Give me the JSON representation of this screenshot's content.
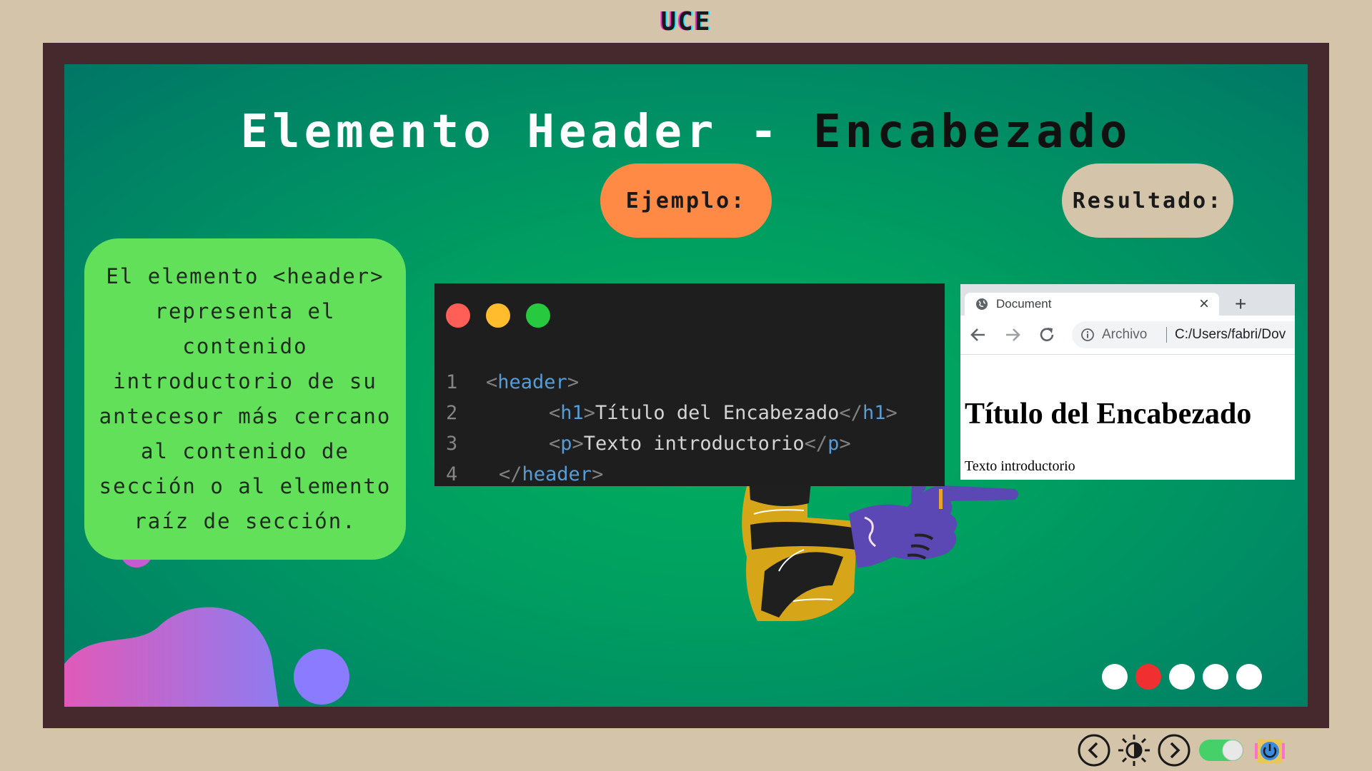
{
  "app": {
    "brand": "UCE"
  },
  "slide": {
    "title_part1": "Elemento Header - ",
    "title_part2": "Encabezado",
    "example_label": "Ejemplo:",
    "result_label": "Resultado:",
    "description": "El elemento <header> representa el contenido introductorio de su antecesor más cercano al contenido de sección o al elemento raíz de sección."
  },
  "code": {
    "lines": [
      {
        "num": "1",
        "open": "<",
        "tag": "header",
        "close": ">"
      },
      {
        "num": "2",
        "open": "<",
        "tag": "h1",
        "close": ">",
        "text": "Título del Encabezado",
        "end_open": "</",
        "end_tag": "h1",
        "end_close": ">"
      },
      {
        "num": "3",
        "open": "<",
        "tag": "p",
        "close": ">",
        "text": "Texto introductorio",
        "end_open": "</",
        "end_tag": "p",
        "end_close": ">"
      },
      {
        "num": "4",
        "open": "</",
        "tag": "header",
        "close": ">"
      }
    ]
  },
  "browser": {
    "tab_title": "Document",
    "tab_close": "×",
    "new_tab": "+",
    "archivo": "Archivo",
    "address": "C:/Users/fabri/Dov",
    "h1": "Título del Encabezado",
    "p": "Texto introductorio"
  },
  "pager": {
    "total": 5,
    "active": 2
  },
  "colors": {
    "accent_orange": "#ff8a45",
    "accent_green": "#62e05a",
    "frame": "#45292c",
    "beige": "#d4c4a9",
    "pager_active": "#f03030"
  },
  "icons": [
    "globe-icon",
    "back-arrow-icon",
    "forward-arrow-icon",
    "reload-icon",
    "info-icon",
    "prev-slide-icon",
    "brightness-icon",
    "next-slide-icon",
    "toggle-switch",
    "power-icon"
  ]
}
